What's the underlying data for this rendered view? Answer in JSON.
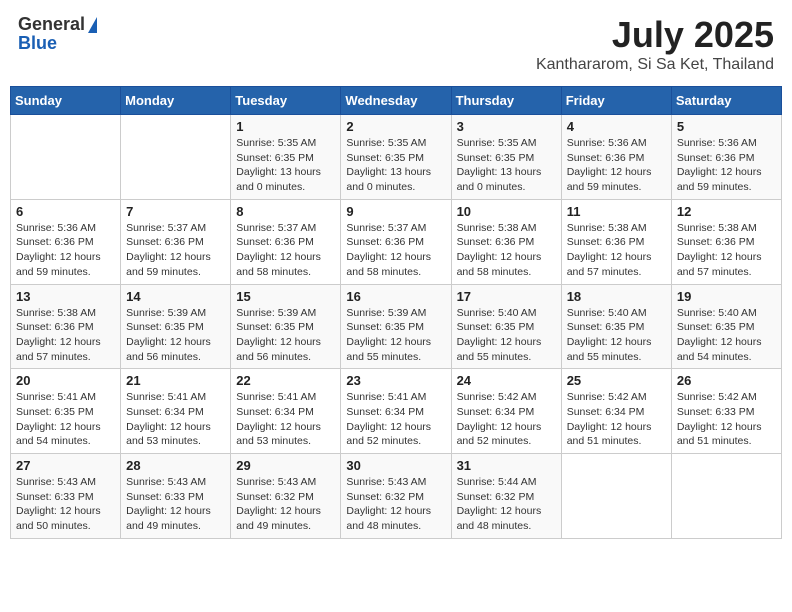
{
  "header": {
    "logo_line1": "General",
    "logo_line2": "Blue",
    "title": "July 2025",
    "subtitle": "Kanthararom, Si Sa Ket, Thailand"
  },
  "days_of_week": [
    "Sunday",
    "Monday",
    "Tuesday",
    "Wednesday",
    "Thursday",
    "Friday",
    "Saturday"
  ],
  "weeks": [
    [
      {
        "day": "",
        "sunrise": "",
        "sunset": "",
        "daylight": ""
      },
      {
        "day": "",
        "sunrise": "",
        "sunset": "",
        "daylight": ""
      },
      {
        "day": "1",
        "sunrise": "Sunrise: 5:35 AM",
        "sunset": "Sunset: 6:35 PM",
        "daylight": "Daylight: 13 hours and 0 minutes."
      },
      {
        "day": "2",
        "sunrise": "Sunrise: 5:35 AM",
        "sunset": "Sunset: 6:35 PM",
        "daylight": "Daylight: 13 hours and 0 minutes."
      },
      {
        "day": "3",
        "sunrise": "Sunrise: 5:35 AM",
        "sunset": "Sunset: 6:35 PM",
        "daylight": "Daylight: 13 hours and 0 minutes."
      },
      {
        "day": "4",
        "sunrise": "Sunrise: 5:36 AM",
        "sunset": "Sunset: 6:36 PM",
        "daylight": "Daylight: 12 hours and 59 minutes."
      },
      {
        "day": "5",
        "sunrise": "Sunrise: 5:36 AM",
        "sunset": "Sunset: 6:36 PM",
        "daylight": "Daylight: 12 hours and 59 minutes."
      }
    ],
    [
      {
        "day": "6",
        "sunrise": "Sunrise: 5:36 AM",
        "sunset": "Sunset: 6:36 PM",
        "daylight": "Daylight: 12 hours and 59 minutes."
      },
      {
        "day": "7",
        "sunrise": "Sunrise: 5:37 AM",
        "sunset": "Sunset: 6:36 PM",
        "daylight": "Daylight: 12 hours and 59 minutes."
      },
      {
        "day": "8",
        "sunrise": "Sunrise: 5:37 AM",
        "sunset": "Sunset: 6:36 PM",
        "daylight": "Daylight: 12 hours and 58 minutes."
      },
      {
        "day": "9",
        "sunrise": "Sunrise: 5:37 AM",
        "sunset": "Sunset: 6:36 PM",
        "daylight": "Daylight: 12 hours and 58 minutes."
      },
      {
        "day": "10",
        "sunrise": "Sunrise: 5:38 AM",
        "sunset": "Sunset: 6:36 PM",
        "daylight": "Daylight: 12 hours and 58 minutes."
      },
      {
        "day": "11",
        "sunrise": "Sunrise: 5:38 AM",
        "sunset": "Sunset: 6:36 PM",
        "daylight": "Daylight: 12 hours and 57 minutes."
      },
      {
        "day": "12",
        "sunrise": "Sunrise: 5:38 AM",
        "sunset": "Sunset: 6:36 PM",
        "daylight": "Daylight: 12 hours and 57 minutes."
      }
    ],
    [
      {
        "day": "13",
        "sunrise": "Sunrise: 5:38 AM",
        "sunset": "Sunset: 6:36 PM",
        "daylight": "Daylight: 12 hours and 57 minutes."
      },
      {
        "day": "14",
        "sunrise": "Sunrise: 5:39 AM",
        "sunset": "Sunset: 6:35 PM",
        "daylight": "Daylight: 12 hours and 56 minutes."
      },
      {
        "day": "15",
        "sunrise": "Sunrise: 5:39 AM",
        "sunset": "Sunset: 6:35 PM",
        "daylight": "Daylight: 12 hours and 56 minutes."
      },
      {
        "day": "16",
        "sunrise": "Sunrise: 5:39 AM",
        "sunset": "Sunset: 6:35 PM",
        "daylight": "Daylight: 12 hours and 55 minutes."
      },
      {
        "day": "17",
        "sunrise": "Sunrise: 5:40 AM",
        "sunset": "Sunset: 6:35 PM",
        "daylight": "Daylight: 12 hours and 55 minutes."
      },
      {
        "day": "18",
        "sunrise": "Sunrise: 5:40 AM",
        "sunset": "Sunset: 6:35 PM",
        "daylight": "Daylight: 12 hours and 55 minutes."
      },
      {
        "day": "19",
        "sunrise": "Sunrise: 5:40 AM",
        "sunset": "Sunset: 6:35 PM",
        "daylight": "Daylight: 12 hours and 54 minutes."
      }
    ],
    [
      {
        "day": "20",
        "sunrise": "Sunrise: 5:41 AM",
        "sunset": "Sunset: 6:35 PM",
        "daylight": "Daylight: 12 hours and 54 minutes."
      },
      {
        "day": "21",
        "sunrise": "Sunrise: 5:41 AM",
        "sunset": "Sunset: 6:34 PM",
        "daylight": "Daylight: 12 hours and 53 minutes."
      },
      {
        "day": "22",
        "sunrise": "Sunrise: 5:41 AM",
        "sunset": "Sunset: 6:34 PM",
        "daylight": "Daylight: 12 hours and 53 minutes."
      },
      {
        "day": "23",
        "sunrise": "Sunrise: 5:41 AM",
        "sunset": "Sunset: 6:34 PM",
        "daylight": "Daylight: 12 hours and 52 minutes."
      },
      {
        "day": "24",
        "sunrise": "Sunrise: 5:42 AM",
        "sunset": "Sunset: 6:34 PM",
        "daylight": "Daylight: 12 hours and 52 minutes."
      },
      {
        "day": "25",
        "sunrise": "Sunrise: 5:42 AM",
        "sunset": "Sunset: 6:34 PM",
        "daylight": "Daylight: 12 hours and 51 minutes."
      },
      {
        "day": "26",
        "sunrise": "Sunrise: 5:42 AM",
        "sunset": "Sunset: 6:33 PM",
        "daylight": "Daylight: 12 hours and 51 minutes."
      }
    ],
    [
      {
        "day": "27",
        "sunrise": "Sunrise: 5:43 AM",
        "sunset": "Sunset: 6:33 PM",
        "daylight": "Daylight: 12 hours and 50 minutes."
      },
      {
        "day": "28",
        "sunrise": "Sunrise: 5:43 AM",
        "sunset": "Sunset: 6:33 PM",
        "daylight": "Daylight: 12 hours and 49 minutes."
      },
      {
        "day": "29",
        "sunrise": "Sunrise: 5:43 AM",
        "sunset": "Sunset: 6:32 PM",
        "daylight": "Daylight: 12 hours and 49 minutes."
      },
      {
        "day": "30",
        "sunrise": "Sunrise: 5:43 AM",
        "sunset": "Sunset: 6:32 PM",
        "daylight": "Daylight: 12 hours and 48 minutes."
      },
      {
        "day": "31",
        "sunrise": "Sunrise: 5:44 AM",
        "sunset": "Sunset: 6:32 PM",
        "daylight": "Daylight: 12 hours and 48 minutes."
      },
      {
        "day": "",
        "sunrise": "",
        "sunset": "",
        "daylight": ""
      },
      {
        "day": "",
        "sunrise": "",
        "sunset": "",
        "daylight": ""
      }
    ]
  ]
}
